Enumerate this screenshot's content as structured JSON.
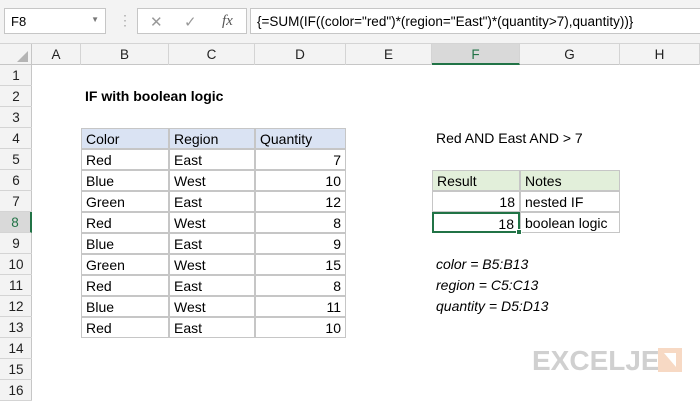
{
  "namebox": "F8",
  "formula": "{=SUM(IF((color=\"red\")*(region=\"East\")*(quantity>7),quantity))}",
  "columns": [
    "A",
    "B",
    "C",
    "D",
    "E",
    "F",
    "G",
    "H"
  ],
  "selected_column": "F",
  "rows": [
    "1",
    "2",
    "3",
    "4",
    "5",
    "6",
    "7",
    "8",
    "9",
    "10",
    "11",
    "12",
    "13",
    "14",
    "15",
    "16"
  ],
  "selected_row": "8",
  "title": "IF with boolean logic",
  "table": {
    "headers": [
      "Color",
      "Region",
      "Quantity"
    ],
    "rows": [
      [
        "Red",
        "East",
        "7"
      ],
      [
        "Blue",
        "West",
        "10"
      ],
      [
        "Green",
        "East",
        "12"
      ],
      [
        "Red",
        "West",
        "8"
      ],
      [
        "Blue",
        "East",
        "9"
      ],
      [
        "Green",
        "West",
        "15"
      ],
      [
        "Red",
        "East",
        "8"
      ],
      [
        "Blue",
        "West",
        "11"
      ],
      [
        "Red",
        "East",
        "10"
      ]
    ]
  },
  "criteria": "Red AND East AND > 7",
  "results": {
    "headers": [
      "Result",
      "Notes"
    ],
    "rows": [
      [
        "18",
        "nested IF"
      ],
      [
        "18",
        "boolean logic"
      ]
    ]
  },
  "named_ranges": [
    "color = B5:B13",
    "region = C5:C13",
    "quantity = D5:D13"
  ],
  "logo": "EXCELJET"
}
